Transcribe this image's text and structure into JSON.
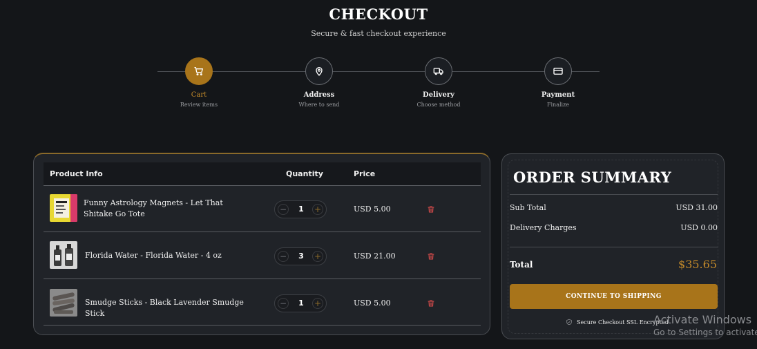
{
  "header": {
    "title": "CHECKOUT",
    "subtitle": "Secure & fast checkout experience"
  },
  "steps": [
    {
      "label": "Cart",
      "sub": "Review items",
      "icon": "cart-icon",
      "active": true
    },
    {
      "label": "Address",
      "sub": "Where to send",
      "icon": "location-pin-icon",
      "active": false
    },
    {
      "label": "Delivery",
      "sub": "Choose method",
      "icon": "truck-icon",
      "active": false
    },
    {
      "label": "Payment",
      "sub": "Finalize",
      "icon": "credit-card-icon",
      "active": false
    }
  ],
  "cart": {
    "columns": {
      "product": "Product Info",
      "quantity": "Quantity",
      "price": "Price"
    },
    "items": [
      {
        "name": "Funny Astrology Magnets - Let That Shitake Go Tote",
        "qty": "1",
        "price": "USD 5.00",
        "minus": "−",
        "plus": "+"
      },
      {
        "name": "Florida Water - Florida Water - 4 oz",
        "qty": "3",
        "price": "USD 21.00",
        "minus": "−",
        "plus": "+"
      },
      {
        "name": "Smudge Sticks - Black Lavender Smudge Stick",
        "qty": "1",
        "price": "USD 5.00",
        "minus": "−",
        "plus": "+"
      }
    ]
  },
  "summary": {
    "title": "ORDER SUMMARY",
    "subtotal_label": "Sub Total",
    "subtotal_value": "USD 31.00",
    "delivery_label": "Delivery Charges",
    "delivery_value": "USD 0.00",
    "total_label": "Total",
    "total_value": "$35.65",
    "button": "CONTINUE TO SHIPPING",
    "secure_text": "Secure Checkout SSL Encrypted"
  },
  "watermark": {
    "line1": "Activate Windows",
    "line2": "Go to Settings to activate Windows."
  },
  "colors": {
    "accent": "#a8741a",
    "accent_text": "#c38a2a",
    "background": "#141619",
    "panel": "#202328",
    "delete": "#d24a4a"
  }
}
